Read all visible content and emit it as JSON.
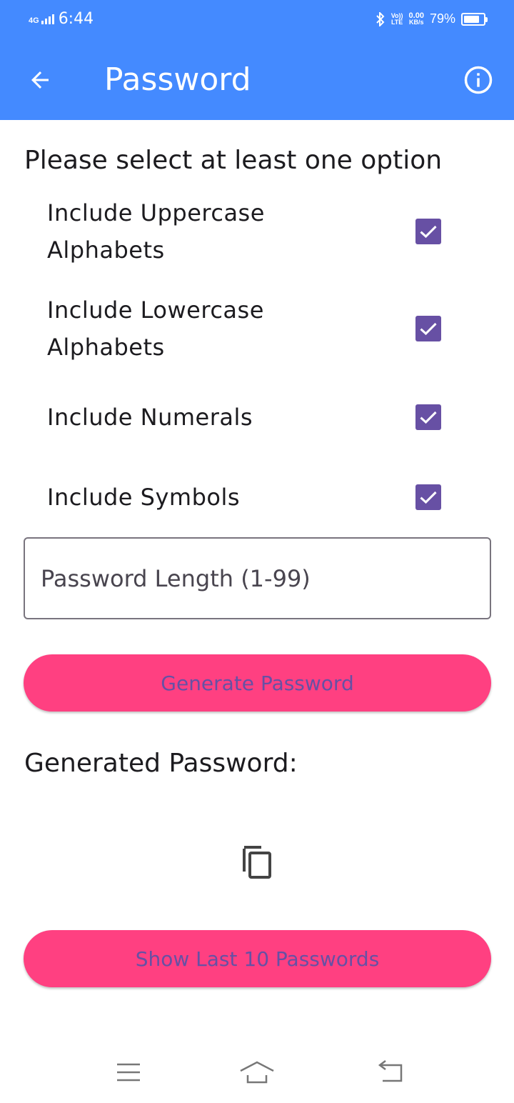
{
  "status_bar": {
    "network_type": "4G",
    "time": "6:44",
    "volte_top": "Vo))",
    "volte_bottom": "LTE",
    "data_speed_value": "0.00",
    "data_speed_unit": "KB/s",
    "battery_percent": "79%",
    "battery_level": 0.79,
    "icons": [
      "signal-icon",
      "bluetooth-icon",
      "volte-icon",
      "battery-icon"
    ]
  },
  "app_bar": {
    "title": "Password",
    "back_icon": "arrow-back-icon",
    "info_icon": "info-icon",
    "background": "#448aff"
  },
  "options": {
    "heading": "Please select at least one option",
    "items": [
      {
        "label": "Include Uppercase Alphabets",
        "checked": true
      },
      {
        "label": "Include Lowercase Alphabets",
        "checked": true
      },
      {
        "label": "Include Numerals",
        "checked": true
      },
      {
        "label": "Include Symbols",
        "checked": true
      }
    ],
    "checkbox_color": "#6750a4"
  },
  "length_field": {
    "placeholder": "Password Length (1-99)",
    "value": ""
  },
  "generate_button": {
    "label": "Generate Password",
    "background": "#ff4081",
    "text_color": "#6750a4"
  },
  "generated": {
    "heading": "Generated Password:",
    "value": "",
    "copy_icon": "copy-icon"
  },
  "history_button": {
    "label": "Show Last 10 Passwords"
  },
  "nav_bar": {
    "icons": [
      "menu-icon",
      "home-icon",
      "back-nav-icon"
    ]
  }
}
